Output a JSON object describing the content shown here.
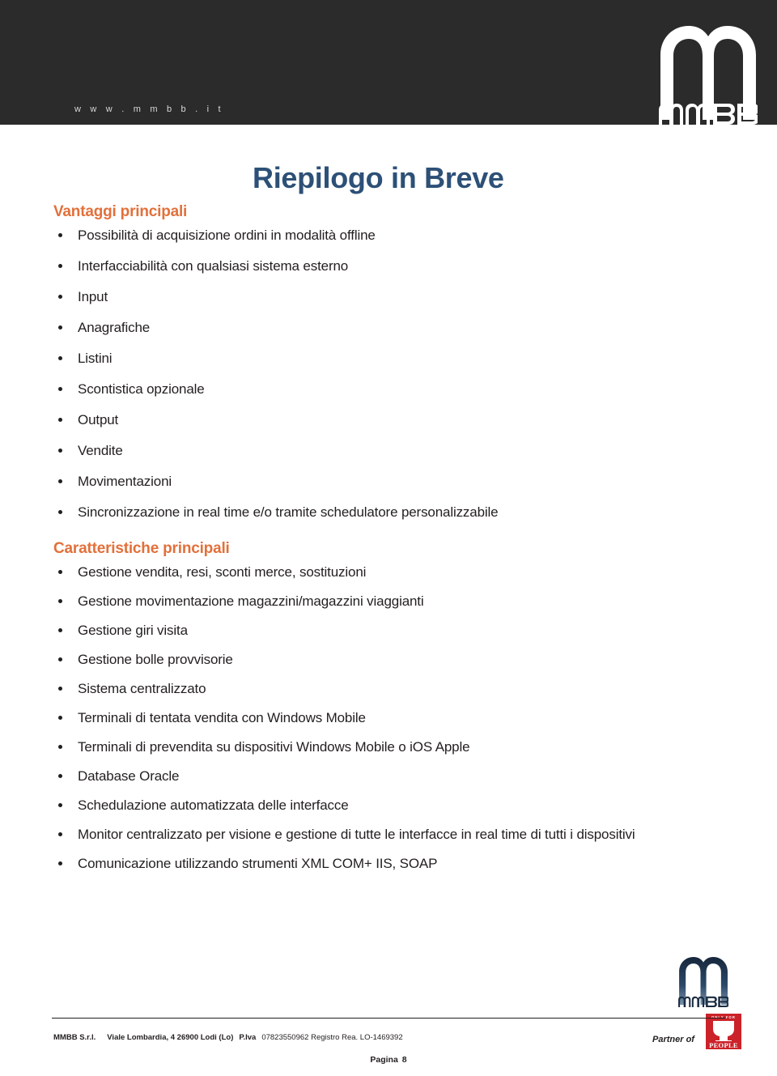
{
  "header": {
    "website_url": "w w w . m m b b . i t",
    "logo_wordmark": "MMBB",
    "band_color": "#2b2b2b"
  },
  "page_title": "Riepilogo in Breve",
  "title_color": "#2d5077",
  "heading_color": "#e2703a",
  "sections": [
    {
      "heading": "Vantaggi principali",
      "items": [
        "Possibilità di acquisizione ordini in modalità offline",
        "Interfacciabilità con qualsiasi sistema esterno",
        "Input",
        "Anagrafiche",
        "Listini",
        "Scontistica opzionale",
        "Output",
        "Vendite",
        "Movimentazioni",
        "Sincronizzazione in real time e/o tramite schedulatore personalizzabile"
      ]
    },
    {
      "heading": "Caratteristiche principali",
      "items": [
        "Gestione vendita, resi, sconti merce, sostituzioni",
        "Gestione movimentazione magazzini/magazzini viaggianti",
        "Gestione giri visita",
        "Gestione bolle provvisorie",
        "Sistema centralizzato",
        "Terminali di tentata vendita con Windows Mobile",
        "Terminali di prevendita su dispositivi Windows Mobile o iOS Apple",
        "Database Oracle",
        "Schedulazione automatizzata delle interfacce",
        "Monitor centralizzato per visione e gestione di tutte le interfacce in real time di tutti i dispositivi",
        "Comunicazione utilizzando strumenti XML COM+ IIS, SOAP"
      ]
    }
  ],
  "footer": {
    "logo_wordmark": "MMBB",
    "partner_of_label": "Partner of",
    "people_badge": {
      "top_text": "ONLY FOR",
      "bottom_text": "PEOPLE",
      "color": "#cc2229"
    },
    "legal": {
      "company": "MMBB S.r.l.",
      "address": "Viale Lombardia, 4 26900 Lodi (Lo)",
      "vat_label": "P.Iva",
      "vat_number": "07823550962 Registro Rea. LO-1469392"
    },
    "page_label": "Pagina",
    "page_number": "8"
  }
}
